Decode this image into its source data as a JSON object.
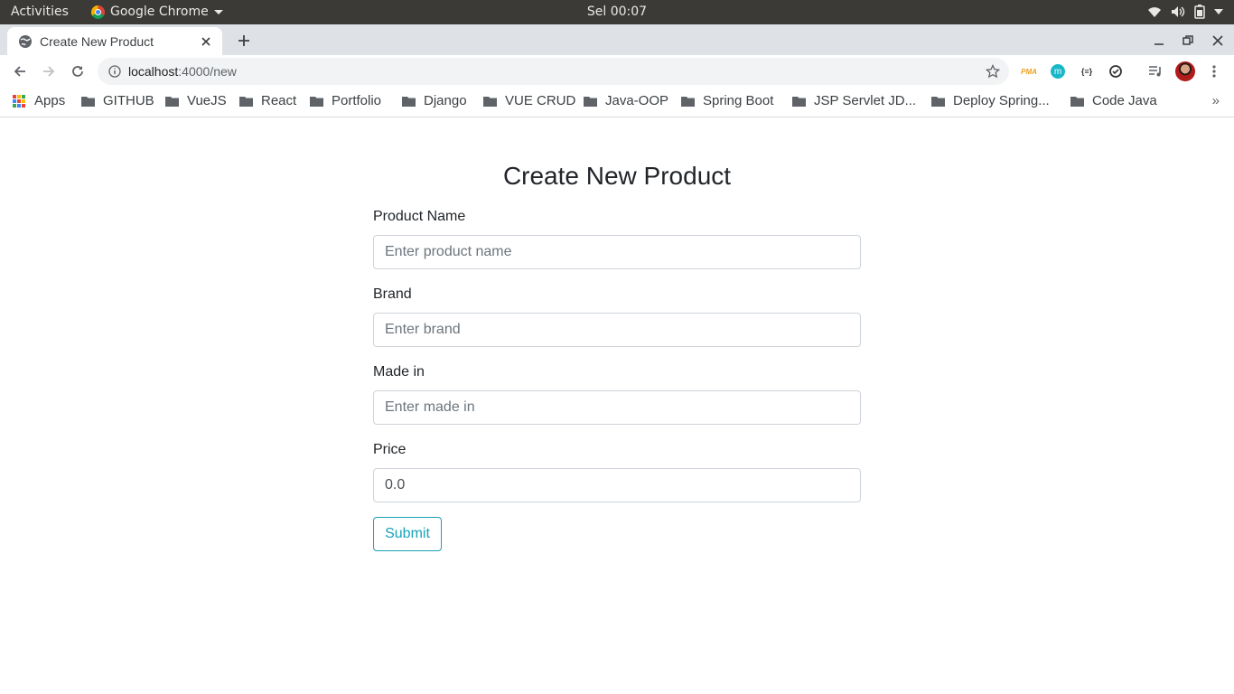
{
  "system_bar": {
    "activities": "Activities",
    "app_name": "Google Chrome",
    "clock": "Sel 00:07",
    "icons": [
      "wifi-icon",
      "volume-icon",
      "battery-icon",
      "system-menu-caret-icon"
    ]
  },
  "browser": {
    "tab": {
      "title": "Create New Product",
      "icon": "globe-icon"
    },
    "address": {
      "host": "localhost",
      "path": ":4000/new"
    },
    "extensions": [
      "PMA",
      "m",
      "{≡}"
    ],
    "bookmarks": [
      {
        "label": "Apps",
        "icon": "apps-grid-icon"
      },
      {
        "label": "GITHUB",
        "icon": "folder-icon"
      },
      {
        "label": "VueJS",
        "icon": "folder-icon"
      },
      {
        "label": "React",
        "icon": "folder-icon"
      },
      {
        "label": "Portfolio",
        "icon": "folder-icon"
      },
      {
        "label": "Django",
        "icon": "folder-icon"
      },
      {
        "label": "VUE CRUD",
        "icon": "folder-icon"
      },
      {
        "label": "Java-OOP",
        "icon": "folder-icon"
      },
      {
        "label": "Spring Boot",
        "icon": "folder-icon"
      },
      {
        "label": "JSP Servlet JD...",
        "icon": "folder-icon"
      },
      {
        "label": "Deploy Spring...",
        "icon": "folder-icon"
      },
      {
        "label": "Code Java",
        "icon": "folder-icon"
      }
    ],
    "bookmarks_overflow": "»"
  },
  "form": {
    "title": "Create New Product",
    "fields": [
      {
        "label": "Product Name",
        "placeholder": "Enter product name",
        "value": ""
      },
      {
        "label": "Brand",
        "placeholder": "Enter brand",
        "value": ""
      },
      {
        "label": "Made in",
        "placeholder": "Enter made in",
        "value": ""
      },
      {
        "label": "Price",
        "placeholder": "",
        "value": "0.0"
      }
    ],
    "submit_label": "Submit"
  },
  "colors": {
    "accent": "#17a2b8",
    "topbar": "#3b3a36",
    "tabstrip": "#dee1e6",
    "omnibox": "#f1f3f4",
    "folder": "#5f6368"
  }
}
